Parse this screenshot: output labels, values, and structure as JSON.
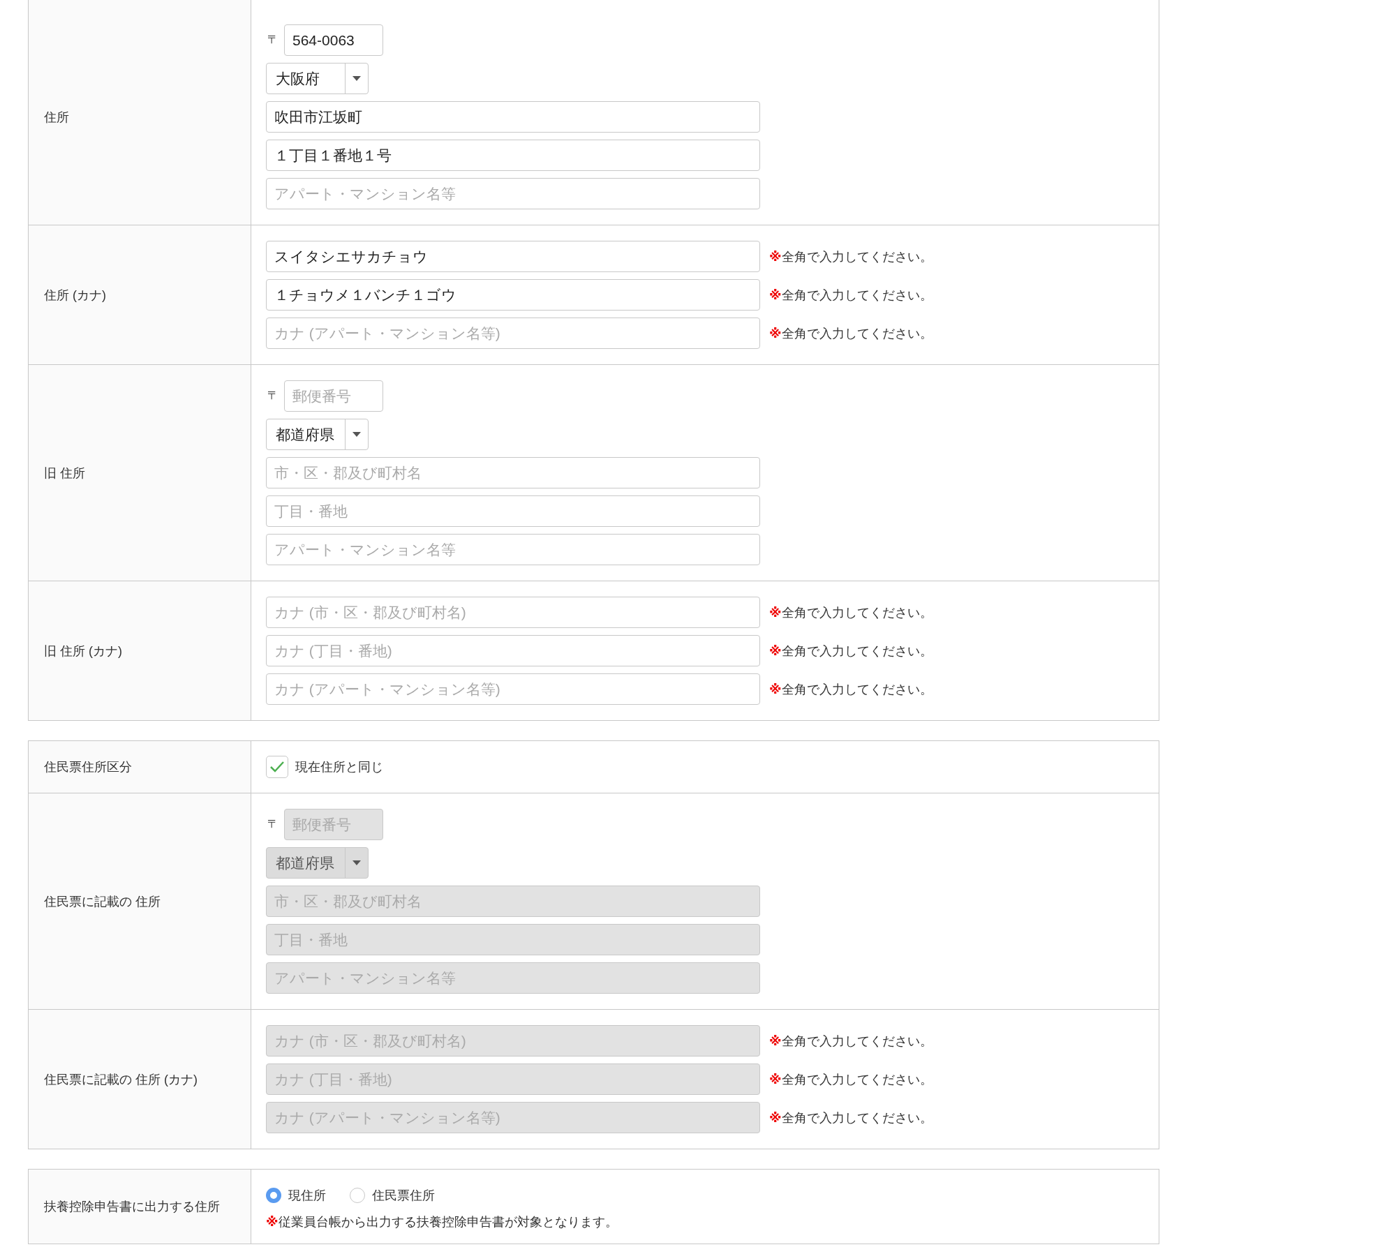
{
  "sections": [
    {
      "rows": [
        {
          "kind": "address",
          "label": "住所",
          "disabled": false,
          "zip": {
            "prefix": "〒",
            "value": "564-0063"
          },
          "prefecture": {
            "value": "大阪府"
          },
          "fields": [
            {
              "value": "吹田市江坂町"
            },
            {
              "value": "１丁目１番地１号"
            },
            {
              "placeholder": "アパート・マンション名等"
            }
          ]
        },
        {
          "kind": "kana",
          "label": "住所 (カナ)",
          "disabled": false,
          "fields": [
            {
              "value": "スイタシエサカチョウ",
              "note_mark": "※",
              "note": "全角で入力してください。"
            },
            {
              "value": "１チョウメ１バンチ１ゴウ",
              "note_mark": "※",
              "note": "全角で入力してください。"
            },
            {
              "placeholder": "カナ (アパート・マンション名等)",
              "note_mark": "※",
              "note": "全角で入力してください。"
            }
          ]
        },
        {
          "kind": "address",
          "label": "旧 住所",
          "disabled": false,
          "zip": {
            "prefix": "〒",
            "placeholder": "郵便番号"
          },
          "prefecture": {
            "value": "都道府県"
          },
          "fields": [
            {
              "placeholder": "市・区・郡及び町村名"
            },
            {
              "placeholder": "丁目・番地"
            },
            {
              "placeholder": "アパート・マンション名等"
            }
          ]
        },
        {
          "kind": "kana",
          "label": "旧 住所 (カナ)",
          "disabled": false,
          "fields": [
            {
              "placeholder": "カナ (市・区・郡及び町村名)",
              "note_mark": "※",
              "note": "全角で入力してください。"
            },
            {
              "placeholder": "カナ (丁目・番地)",
              "note_mark": "※",
              "note": "全角で入力してください。"
            },
            {
              "placeholder": "カナ (アパート・マンション名等)",
              "note_mark": "※",
              "note": "全角で入力してください。"
            }
          ]
        }
      ]
    },
    {
      "rows": [
        {
          "kind": "checkbox",
          "label": "住民票住所区分",
          "option": {
            "label": "現在住所と同じ",
            "checked": true
          }
        },
        {
          "kind": "address",
          "label": "住民票に記載の 住所",
          "disabled": true,
          "zip": {
            "prefix": "〒",
            "placeholder": "郵便番号"
          },
          "prefecture": {
            "value": "都道府県"
          },
          "fields": [
            {
              "placeholder": "市・区・郡及び町村名"
            },
            {
              "placeholder": "丁目・番地"
            },
            {
              "placeholder": "アパート・マンション名等"
            }
          ]
        },
        {
          "kind": "kana",
          "label": "住民票に記載の 住所 (カナ)",
          "disabled": true,
          "fields": [
            {
              "placeholder": "カナ (市・区・郡及び町村名)",
              "note_mark": "※",
              "note": "全角で入力してください。"
            },
            {
              "placeholder": "カナ (丁目・番地)",
              "note_mark": "※",
              "note": "全角で入力してください。"
            },
            {
              "placeholder": "カナ (アパート・マンション名等)",
              "note_mark": "※",
              "note": "全角で入力してください。"
            }
          ]
        }
      ]
    },
    {
      "rows": [
        {
          "kind": "radio",
          "label": "扶養控除申告書に出力する住所",
          "options": [
            {
              "label": "現住所",
              "selected": true
            },
            {
              "label": "住民票住所",
              "selected": false
            }
          ],
          "note_mark": "※",
          "note": "従業員台帳から出力する扶養控除申告書が対象となります。"
        }
      ]
    }
  ]
}
